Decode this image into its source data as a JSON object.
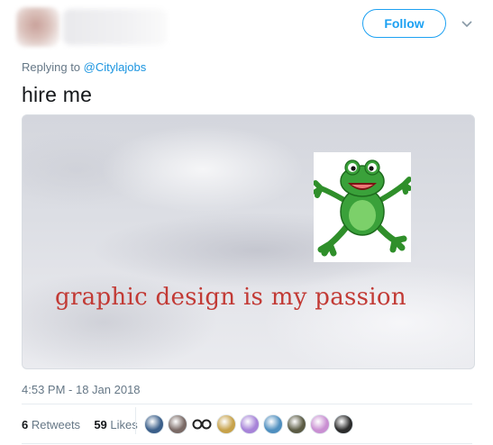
{
  "header": {
    "follow_label": "Follow",
    "caret_icon": "chevron-down-icon"
  },
  "reply": {
    "prefix": "Replying to",
    "handle": "@Citylajobs"
  },
  "tweet": {
    "text": "hire me",
    "image_caption": "graphic design is my passion"
  },
  "meta": {
    "timestamp": "4:53 PM - 18 Jan 2018"
  },
  "stats": {
    "retweets_count": "6",
    "retweets_label": "Retweets",
    "likes_count": "59",
    "likes_label": "Likes"
  },
  "likers": [
    {
      "icon": "avatar-icon",
      "color": "#3b5f8a"
    },
    {
      "icon": "avatar-icon",
      "color": "#7a6a66"
    },
    {
      "icon": "glasses-icon",
      "color": "#ffffff"
    },
    {
      "icon": "avatar-icon",
      "color": "#c7a24a"
    },
    {
      "icon": "avatar-icon",
      "color": "#a783d8"
    },
    {
      "icon": "avatar-icon",
      "color": "#4f8fbf"
    },
    {
      "icon": "avatar-icon",
      "color": "#5b5b44"
    },
    {
      "icon": "avatar-icon",
      "color": "#c98fd2"
    },
    {
      "icon": "avatar-icon",
      "color": "#2c2c2c"
    }
  ],
  "colors": {
    "accent": "#1da1f2",
    "link": "#1b95e0",
    "muted": "#657786",
    "caption_red": "#c23a35"
  }
}
